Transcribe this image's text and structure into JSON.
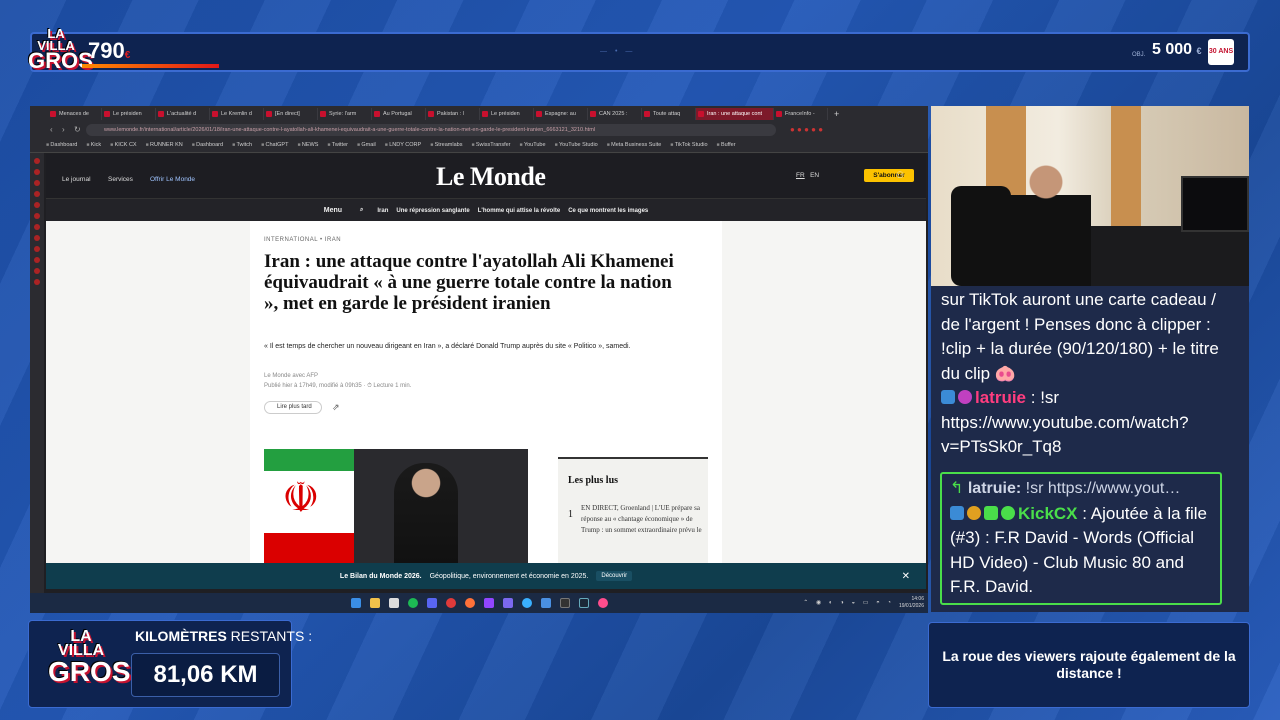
{
  "overlay": {
    "logo_top": "LA VILLA",
    "logo_bottom": "GROS",
    "logo_mid": "DES",
    "counter": "790",
    "counter_unit": "€",
    "goal_label": "OBJ.",
    "goal": "5 000",
    "goal_unit": "€",
    "goal_badge": "30 ANS",
    "top_progress_pct": 12,
    "km_label_bold": "KILOMÈTRES",
    "km_label_rest": "RESTANTS :",
    "km_value": "81,06 KM",
    "roue_text": "La roue des viewers rajoute également de la distance !"
  },
  "browser": {
    "tabs": [
      "Menaces de",
      "Le présiden",
      "L'actualité d",
      "Le Kremlin d",
      "[En direct]",
      "Syrie: l'arm",
      "Au Portugal",
      "Pakistan : l",
      "Le présiden",
      "Espagne: au",
      "CAN 2025 :",
      "Toute attaq",
      "Iran : une attaque cont",
      "FranceInfo -"
    ],
    "active_tab_index": 12,
    "url": "www.lemonde.fr/international/article/2026/01/18/iran-une-attaque-contre-l-ayatollah-ali-khamenei-equivaudrait-a-une-guerre-totale-contre-la-nation-met-en-garde-le-president-iranien_6663121_3210.html",
    "bookmarks": [
      "Dashboard",
      "Kick",
      "KICK CX",
      "RUNNER KN",
      "Dashboard",
      "Twitch",
      "ChatGPT",
      "NEWS",
      "Twitter",
      "Gmail",
      "LNDY CORP",
      "Streamlabs",
      "SwissTransfer",
      "YouTube",
      "YouTube Studio",
      "Meta Business Suite",
      "TikTok Studio",
      "Buffer"
    ]
  },
  "site": {
    "logo": "Le Monde",
    "header_links": [
      "Le journal",
      "Services",
      "Offrir Le Monde"
    ],
    "lang_fr": "FR",
    "lang_en": "EN",
    "subscribe": "S'abonner",
    "nav": [
      "Menu",
      "Iran",
      "Une répression sanglante",
      "L'homme qui attise la révolte",
      "Ce que montrent les images"
    ],
    "kicker": "INTERNATIONAL • IRAN",
    "title": "Iran : une attaque contre l'ayatollah Ali Khamenei équivaudrait « à une guerre totale contre la nation », met en garde le président iranien",
    "chapo": "« Il est temps de chercher un nouveau dirigeant en Iran », a déclaré Donald Trump auprès du site « Politico », samedi.",
    "byline": "Le Monde avec AFP",
    "published": "Publié hier à 17h49, modifié à 09h35 · ⏱ Lecture 1 min.",
    "save_label": "Lire plus tard",
    "most_read_title": "Les plus lus",
    "most_read_num": "1",
    "most_read_text": "EN DIRECT, Groenland | L'UE prépare sa réponse au « chantage économique » de Trump : un sommet extraordinaire prévu le",
    "banner_bold": "Le Bilan du Monde 2026.",
    "banner_text": "Géopolitique, environnement et économie en 2025.",
    "banner_cta": "Découvrir",
    "banner_close": "✕"
  },
  "taskbar": {
    "time": "14:06",
    "date": "19/01/2026"
  },
  "chat": {
    "line1": "sur TikTok auront une carte cadeau / de l'argent ! Penses donc à clipper : !clip + la durée (90/120/180) + le titre du clip 🐽",
    "user2": "latruie",
    "msg2": " : !sr https://www.youtube.com/watch?v=PTsSk0r_Tq8",
    "reply_user": "latruie:",
    "reply_quoted": "!sr https://www.yout…",
    "user3": "KickCX",
    "msg3": " : Ajoutée à la file (#3) : F.R David - Words (Official HD Video) - Club Music 80 and F.R. David."
  }
}
